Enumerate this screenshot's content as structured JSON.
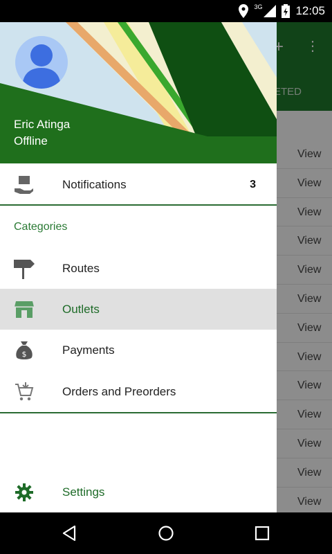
{
  "status_bar": {
    "time": "12:05",
    "network": "3G"
  },
  "background_app": {
    "tab_label": "ETED",
    "rows": [
      "View",
      "View",
      "View",
      "View",
      "View",
      "View",
      "View",
      "View",
      "View",
      "View",
      "View",
      "View",
      "View"
    ]
  },
  "drawer": {
    "user": {
      "name": "Eric Atinga",
      "status": "Offline"
    },
    "notifications": {
      "label": "Notifications",
      "count": "3"
    },
    "section_title": "Categories",
    "items": [
      {
        "label": "Routes",
        "icon": "signpost-icon"
      },
      {
        "label": "Outlets",
        "icon": "store-icon"
      },
      {
        "label": "Payments",
        "icon": "money-bag-icon"
      },
      {
        "label": "Orders and Preorders",
        "icon": "cart-add-icon"
      }
    ],
    "settings": {
      "label": "Settings",
      "icon": "gear-icon"
    },
    "active_item": "Outlets"
  },
  "colors": {
    "primary_green": "#1e6b28",
    "accent_green": "#2a7a34"
  }
}
